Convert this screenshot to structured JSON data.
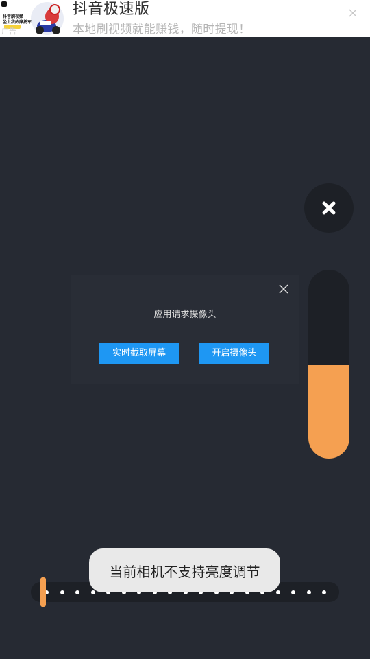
{
  "ad": {
    "title": "抖音极速版",
    "subtitle": "本地刷视频就能赚钱，随时提现！",
    "tag": "广告",
    "thumb_line1": "抖音刷视频",
    "thumb_line2": "坐上我的摩托车",
    "close_icon": "close-icon"
  },
  "dialog": {
    "title": "应用请求摄像头",
    "capture_button": "实时截取屏幕",
    "camera_button": "开启摄像头",
    "close_icon": "close-icon"
  },
  "toast": {
    "message": "当前相机不支持亮度调节"
  },
  "brightness_slider": {
    "level": 0.5
  },
  "dots_slider": {
    "dot_count": 19,
    "thumb_index": 0
  },
  "colors": {
    "background": "#262a33",
    "panel": "#1d2026",
    "accent_orange": "#f5a051",
    "button_blue": "#1e97f3"
  }
}
